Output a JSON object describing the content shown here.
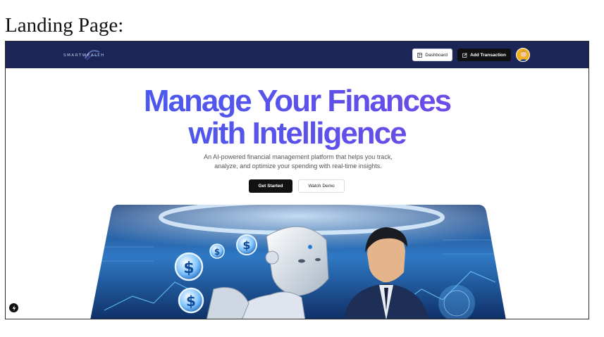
{
  "caption": "Landing Page:",
  "header": {
    "brand": "SMARTWEALTH",
    "dashboard_label": "Dashboard",
    "add_transaction_label": "Add Transaction"
  },
  "hero": {
    "title_line1": "Manage Your Finances",
    "title_line2": "with Intelligence",
    "subtitle_line1": "An AI-powered financial management platform that helps you track,",
    "subtitle_line2": "analyze, and optimize your spending with real-time insights.",
    "primary_cta": "Get Started",
    "secondary_cta": "Watch Demo"
  },
  "colors": {
    "nav_bg": "#1b2657",
    "title_gradient_start": "#3d5ff0",
    "title_gradient_end": "#7d45e6",
    "button_dark": "#111111"
  },
  "icons": {
    "dashboard": "layout-icon",
    "add_transaction": "edit-icon",
    "badge": "bolt-icon"
  }
}
